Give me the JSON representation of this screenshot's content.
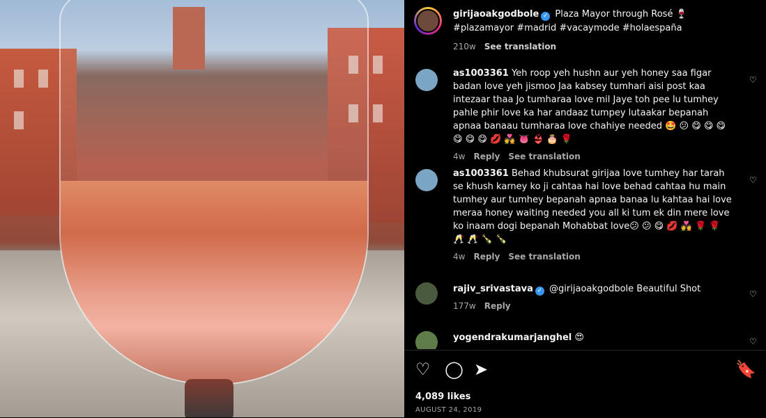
{
  "post": {
    "image_alt": "Glass of rosé wine in front of Plaza Mayor",
    "author": "girijaoakgodbole",
    "caption_line1": "Plaza Mayor through Rosé 🍷",
    "caption_line2": "#plazamayor #madrid #vacaymode #holaespaña",
    "time": "210w",
    "see_translation": "See translation"
  },
  "comments": [
    {
      "user": "as1003361",
      "text": "Yeh roop yeh hushn aur yeh honey saa figar badan love yeh jismoo Jaa kabsey tumhari aisi post kaa intezaar thaa Jo tumharaa love mil Jaye toh pee lu tumhey pahle phir love ka har andaaz tumpey lutaakar bepanah apnaa banaau tumharaa love chahiye needed 🤩 😕 😋 😋 😋 😋 😋 😋 💋 💑 👅 👙 🎂 🌹",
      "time": "4w",
      "reply": "Reply",
      "see_translation": "See translation"
    },
    {
      "user": "as1003361",
      "text": "Behad khubsurat girijaa love tumhey har tarah se khush karney ko ji cahtaa hai love behad cahtaa hu main tumhey aur tumhey bepanah apnaa banaa lu kahtaa hai love meraa honey waiting needed you all ki tum ek din mere love ko inaam dogi bepanah Mohabbat love😕 😕 😋 💋 💑 🌹 🌹 🥂 🥂 🍾 🍾",
      "time": "4w",
      "reply": "Reply",
      "see_translation": "See translation"
    },
    {
      "user": "rajiv_srivastava",
      "text": "@girijaoakgodbole Beautiful Shot",
      "time": "177w",
      "reply": "Reply"
    },
    {
      "user": "yogendrakumarjanghel",
      "text": "😍"
    }
  ],
  "actions": {
    "like_icon": "heart-outline-icon",
    "comment_icon": "comment-icon",
    "share_icon": "send-icon",
    "save_icon": "bookmark-icon"
  },
  "likes": "4,089 likes",
  "date": "AUGUST 24, 2019",
  "colors": {
    "background": "#000000",
    "verified": "#3897f0",
    "muted_text": "#a8a8a8"
  }
}
